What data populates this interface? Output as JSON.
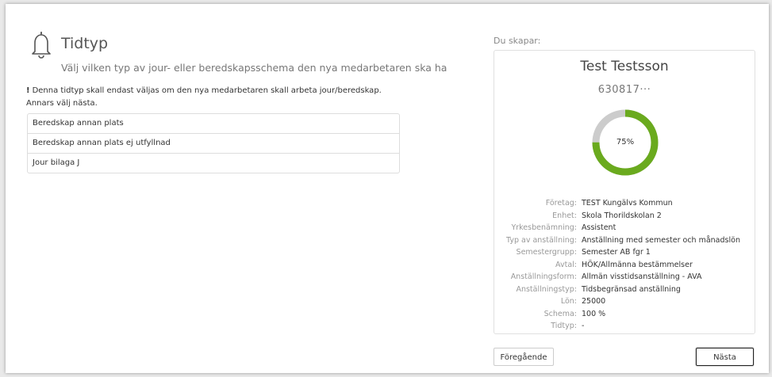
{
  "header": {
    "title": "Tidtyp",
    "subtitle": "Välj vilken typ av jour- eller beredskapsschema den nya medarbetaren ska ha",
    "notice_mark": "!",
    "notice": "Denna tidtyp skall endast väljas om den nya medarbetaren skall arbeta jour/beredskap. Annars välj nästa."
  },
  "tidtyp_options": [
    "Beredskap annan plats",
    "Beredskap annan plats ej utfyllnad",
    "Jour bilaga J"
  ],
  "summary": {
    "label": "Du skapar:",
    "name": "Test Testsson",
    "id": "630817···",
    "progress_percent": 75,
    "progress_text": "75%",
    "progress_color": "#6aaa1e",
    "progress_track_color": "#cccccc",
    "details": [
      {
        "key": "Företag:",
        "value": "TEST Kungälvs Kommun"
      },
      {
        "key": "Enhet:",
        "value": "Skola Thorildskolan 2"
      },
      {
        "key": "Yrkesbenämning:",
        "value": "Assistent"
      },
      {
        "key": "Typ av anställning:",
        "value": "Anställning med semester och månadslön"
      },
      {
        "key": "Semestergrupp:",
        "value": "Semester AB fgr 1"
      },
      {
        "key": "Avtal:",
        "value": "HÖK/Allmänna bestämmelser"
      },
      {
        "key": "Anställningsform:",
        "value": "Allmän visstidsanställning - AVA"
      },
      {
        "key": "Anställningstyp:",
        "value": "Tidsbegränsad anställning"
      },
      {
        "key": "Lön:",
        "value": "25000"
      },
      {
        "key": "Schema:",
        "value": "100 %"
      },
      {
        "key": "Tidtyp:",
        "value": "-"
      }
    ]
  },
  "buttons": {
    "prev": "Föregående",
    "next": "Nästa"
  }
}
